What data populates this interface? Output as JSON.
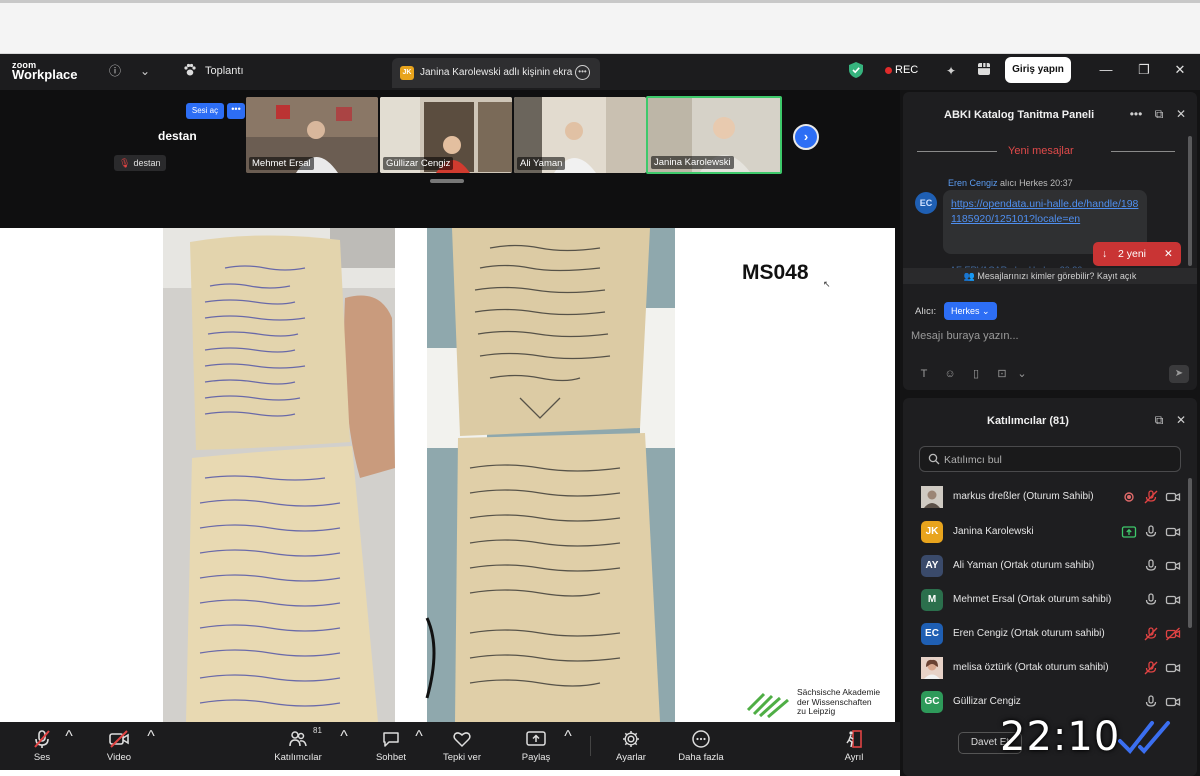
{
  "titlebar": {
    "logo_small": "zoom",
    "logo_large": "Workplace",
    "meeting_label": "Toplantı",
    "share_tab_initials": "JK",
    "share_tab_label": "Janina Karolewski adlı kişinin ekra",
    "rec_label": "REC",
    "login_label": "Giriş yapın"
  },
  "stage": {
    "unmute_label": "Sesi aç",
    "unmute_more": "•••",
    "self_name": "destan",
    "self_tag": "destan",
    "thumbnails": [
      {
        "name": "Mehmet Ersal"
      },
      {
        "name": "Güllizar Cengiz"
      },
      {
        "name": "Ali Yaman"
      },
      {
        "name": "Janina Karolewski"
      }
    ],
    "next_label": "›"
  },
  "shared_screen": {
    "manuscript_id": "MS048",
    "academy_name": [
      "Sächsische Akademie",
      "der Wissenschaften",
      "zu Leipzig"
    ]
  },
  "toolbar": {
    "audio_label": "Ses",
    "video_label": "Video",
    "participants_label": "Katılımcılar",
    "participants_count": "81",
    "chat_label": "Sohbet",
    "react_label": "Tepki ver",
    "share_label": "Paylaş",
    "settings_label": "Ayarlar",
    "more_label": "Daha fazla",
    "leave_label": "Ayrıl"
  },
  "chat": {
    "title": "ABKI Katalog Tanitma Paneli",
    "new_messages": "Yeni mesajlar",
    "message": {
      "avatar": "EC",
      "sender": "Eren Cengiz",
      "to_word": "alıcı",
      "recipient": "Herkes",
      "time": "20:37",
      "text": "https://opendata.uni-halle.de/handle/1981185920/125101?locale=en"
    },
    "new_badge": "2 yeni",
    "peek_text": "AE ERVACAR alıcı Herkes 20:36",
    "privacy_text": "Mesajlarınızı kimler görebilir? Kayıt açık",
    "to_label": "Alıcı:",
    "to_value": "Herkes",
    "input_placeholder": "Mesajı buraya yazın..."
  },
  "participants": {
    "title": "Katılımcılar (81)",
    "search_placeholder": "Katılımcı bul",
    "list": [
      {
        "initials": "",
        "name": "markus dreßler (Oturum Sahibi)",
        "color": "#7a6a60"
      },
      {
        "initials": "JK",
        "name": "Janina Karolewski",
        "color": "#e8a41d"
      },
      {
        "initials": "AY",
        "name": "Ali Yaman (Ortak oturum sahibi)",
        "color": "#3a4a6a"
      },
      {
        "initials": "M",
        "name": "Mehmet Ersal (Ortak oturum sahibi)",
        "color": "#2b6f4c"
      },
      {
        "initials": "EC",
        "name": "Eren Cengiz (Ortak oturum sahibi)",
        "color": "#1f5fb3"
      },
      {
        "initials": "",
        "name": "melisa öztürk (Ortak oturum sahibi)",
        "color": "#c98a7a"
      },
      {
        "initials": "GC",
        "name": "Güllizar Cengiz",
        "color": "#2e9a5a"
      }
    ],
    "invite_label": "Davet Et"
  },
  "overlay": {
    "clock": "22:10"
  },
  "colors": {
    "accent": "#2d6ef5",
    "danger": "#e02b2b",
    "active_speaker": "#3ec96b"
  }
}
